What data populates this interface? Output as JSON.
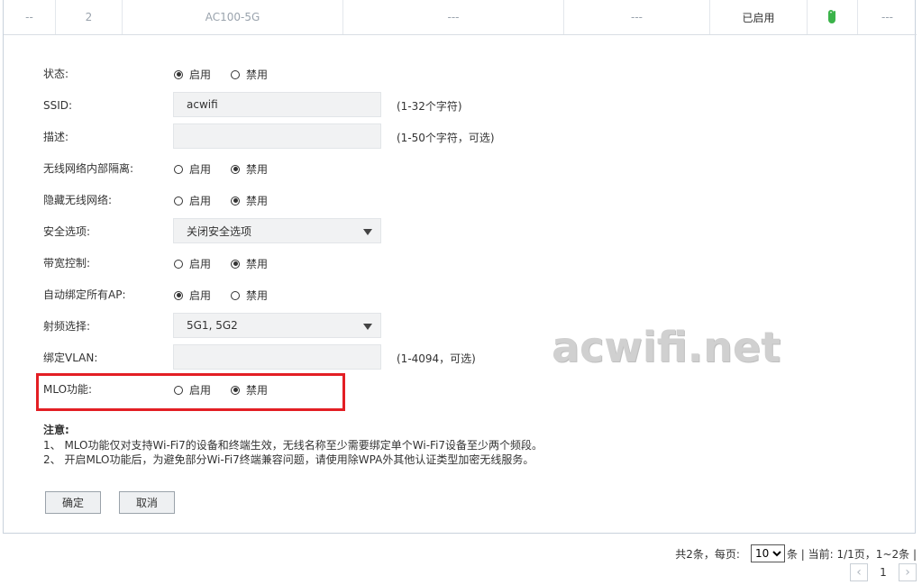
{
  "table_row": {
    "col1": "--",
    "col2": "2",
    "model": "AC100-5G",
    "col4": "---",
    "col5": "---",
    "status": "已启用",
    "col8": "---"
  },
  "form": {
    "status": {
      "label": "状态:",
      "opt1": "启用",
      "opt2": "禁用"
    },
    "ssid": {
      "label": "SSID:",
      "value": "acwifi",
      "hint": "(1-32个字符)"
    },
    "desc": {
      "label": "描述:",
      "value": "",
      "hint": "(1-50个字符，可选)"
    },
    "isolation": {
      "label": "无线网络内部隔离:",
      "opt1": "启用",
      "opt2": "禁用"
    },
    "hide": {
      "label": "隐藏无线网络:",
      "opt1": "启用",
      "opt2": "禁用"
    },
    "security": {
      "label": "安全选项:",
      "value": "关闭安全选项"
    },
    "bandwidth": {
      "label": "带宽控制:",
      "opt1": "启用",
      "opt2": "禁用"
    },
    "autobind": {
      "label": "自动绑定所有AP:",
      "opt1": "启用",
      "opt2": "禁用"
    },
    "radio": {
      "label": "射频选择:",
      "value": "5G1, 5G2"
    },
    "vlan": {
      "label": "绑定VLAN:",
      "value": "",
      "hint": "(1-4094，可选)"
    },
    "mlo": {
      "label": "MLO功能:",
      "opt1": "启用",
      "opt2": "禁用"
    }
  },
  "notes": {
    "title": "注意:",
    "line1": "1、 MLO功能仅对支持Wi-Fi7的设备和终端生效，无线名称至少需要绑定单个Wi-Fi7设备至少两个频段。",
    "line2": "2、 开启MLO功能后，为避免部分Wi-Fi7终端兼容问题，请使用除WPA外其他认证类型加密无线服务。"
  },
  "buttons": {
    "ok": "确定",
    "cancel": "取消"
  },
  "watermark": "acwifi.net",
  "pager": {
    "total_prefix": "共2条，每页:",
    "per_page": "10",
    "suffix": "条 | 当前: 1/1页，1~2条 |",
    "page": "1",
    "prev": "‹",
    "next": "›"
  },
  "colors": {
    "accent_red": "#e31e24",
    "clip_green": "#3bb34a"
  },
  "icons": {
    "attachment": "paperclip-icon"
  }
}
